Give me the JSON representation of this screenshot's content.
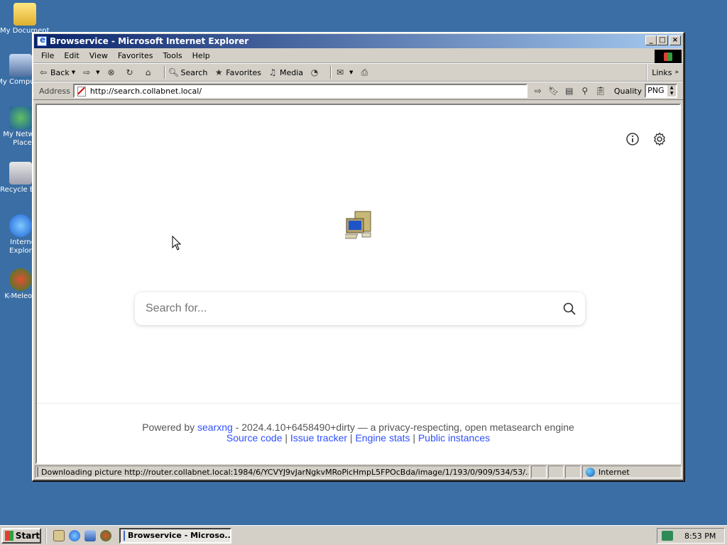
{
  "desktop": {
    "icons": [
      {
        "label": "My Documents"
      },
      {
        "label": "My Computer"
      },
      {
        "label": "My Network Places"
      },
      {
        "label": "Recycle Bin"
      },
      {
        "label": "Internet Explorer"
      },
      {
        "label": "K-Meleon"
      }
    ]
  },
  "window": {
    "title": "Browservice - Microsoft Internet Explorer",
    "menu": [
      "File",
      "Edit",
      "View",
      "Favorites",
      "Tools",
      "Help"
    ],
    "toolbar": {
      "back": "Back",
      "search": "Search",
      "favorites": "Favorites",
      "media": "Media",
      "links": "Links"
    },
    "address": {
      "label": "Address",
      "url": "http://search.collabnet.local/",
      "quality_label": "Quality",
      "quality_value": "PNG"
    }
  },
  "page": {
    "search_placeholder": "Search for...",
    "footer": {
      "powered_by": "Powered by",
      "engine_link": "searxng",
      "version_text": "- 2024.4.10+6458490+dirty — a privacy-respecting, open metasearch engine",
      "links": [
        "Source code",
        "Issue tracker",
        "Engine stats",
        "Public instances"
      ]
    }
  },
  "statusbar": {
    "message": "Downloading picture http://router.collabnet.local:1984/6/YCVYJ9vJarNgkvMRoPicHmpL5FPOcBda/image/1/193/0/909/534/53/...",
    "zone": "Internet"
  },
  "taskbar": {
    "start": "Start",
    "task_label": "Browservice - Microso...",
    "clock": "8:53 PM"
  },
  "colors": {
    "desktop": "#3a6ea5",
    "titlebar_start": "#0a246a",
    "titlebar_end": "#a6caf0",
    "link": "#3050ff"
  }
}
